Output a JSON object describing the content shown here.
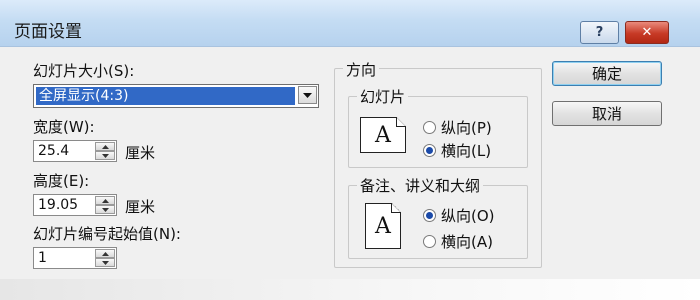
{
  "dialog": {
    "title": "页面设置"
  },
  "titlebar": {
    "help_label": "?",
    "close_label": "✕"
  },
  "slide_size": {
    "label": "幻灯片大小(S):",
    "value": "全屏显示(4:3)"
  },
  "width": {
    "label": "宽度(W):",
    "value": "25.4",
    "unit": "厘米"
  },
  "height": {
    "label": "高度(E):",
    "value": "19.05",
    "unit": "厘米"
  },
  "numbering": {
    "label": "幻灯片编号起始值(N):",
    "value": "1"
  },
  "orientation": {
    "title": "方向",
    "slides": {
      "title": "幻灯片",
      "options": [
        {
          "label": "纵向(P)",
          "selected": false
        },
        {
          "label": "横向(L)",
          "selected": true
        }
      ]
    },
    "notes": {
      "title": "备注、讲义和大纲",
      "options": [
        {
          "label": "纵向(O)",
          "selected": true
        },
        {
          "label": "横向(A)",
          "selected": false
        }
      ]
    }
  },
  "buttons": {
    "ok": "确定",
    "cancel": "取消"
  },
  "icons": {
    "page_letter": "A"
  }
}
